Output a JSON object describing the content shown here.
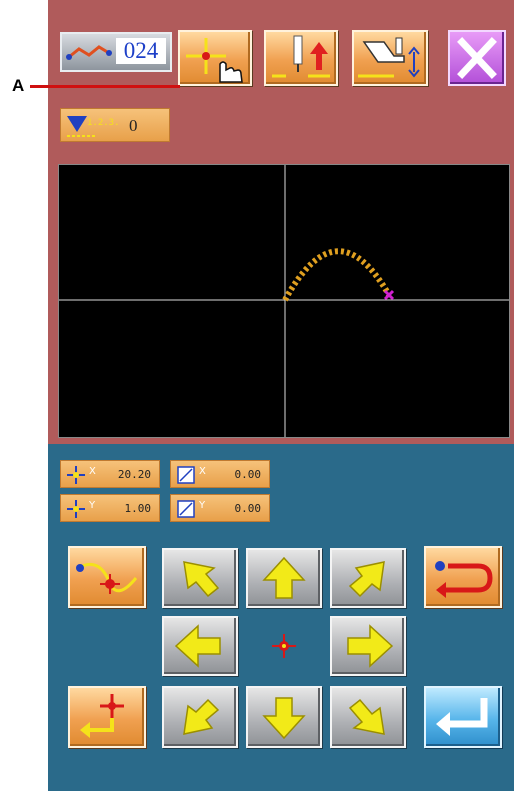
{
  "pattern_number": "024",
  "callout_label": "A",
  "stitch_counter": "0",
  "counter_icon_text": "1.2.3..",
  "displays": {
    "scale_x": {
      "axis": "X",
      "value": "20.20"
    },
    "scale_y": {
      "axis": "Y",
      "value": "1.00"
    },
    "offset_x": {
      "axis": "X",
      "value": "0.00"
    },
    "offset_y": {
      "axis": "Y",
      "value": "0.00"
    }
  },
  "icons": {
    "pattern": "pattern-wave-icon",
    "move_origin": "crosshair-hand-icon",
    "needle_up": "needle-up-icon",
    "presser_foot": "presser-foot-icon",
    "close": "close-icon",
    "curve_point": "curve-point-icon",
    "return": "return-arrow-icon",
    "to_origin": "return-to-origin-icon",
    "enter": "enter-icon"
  },
  "colors": {
    "top_panel": "#b05b5b",
    "bottom_panel": "#2a6a8a",
    "stitch": "#e0a020",
    "current_point": "#d020d0"
  }
}
